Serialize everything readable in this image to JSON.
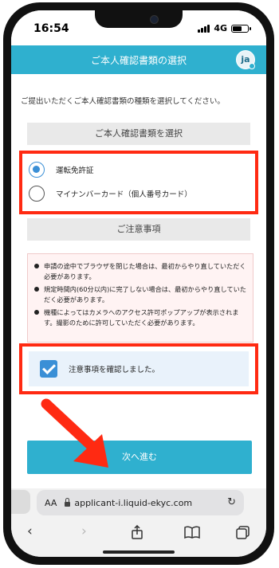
{
  "status": {
    "time": "16:54",
    "network": "4G"
  },
  "header": {
    "title": "ご本人確認書類の選択",
    "avatar_text": "ja"
  },
  "main": {
    "intro": "ご提出いただくご本人確認書類の種類を選択してください。",
    "select_heading": "ご本人確認書類を選択",
    "options": [
      {
        "label": "運転免許証",
        "selected": true
      },
      {
        "label": "マイナンバーカード（個人番号カード）",
        "selected": false
      }
    ],
    "notice_heading": "ご注意事項",
    "notices": [
      "申請の途中でブラウザを閉じた場合は、最初からやり直していただく必要があります。",
      "規定時間内(60分以内)に完了しない場合は、最初からやり直していただく必要があります。",
      "機種によってはカメラへのアクセス許可ポップアップが表示されます。撮影のために許可していただく必要があります。"
    ],
    "confirm_label": "注意事項を確認しました。",
    "confirm_checked": true,
    "next_button": "次へ進む"
  },
  "browser": {
    "aa": "AA",
    "url": "applicant-i.liquid-ekyc.com"
  },
  "colors": {
    "accent": "#2fb0cf",
    "highlight": "#ff2a12",
    "radio": "#3a8fd6"
  },
  "icons": [
    "signal-icon",
    "battery-icon",
    "lock-icon",
    "reload-icon",
    "back-icon",
    "forward-icon",
    "share-icon",
    "bookmarks-icon",
    "tabs-icon",
    "arrow-annotation-icon"
  ]
}
